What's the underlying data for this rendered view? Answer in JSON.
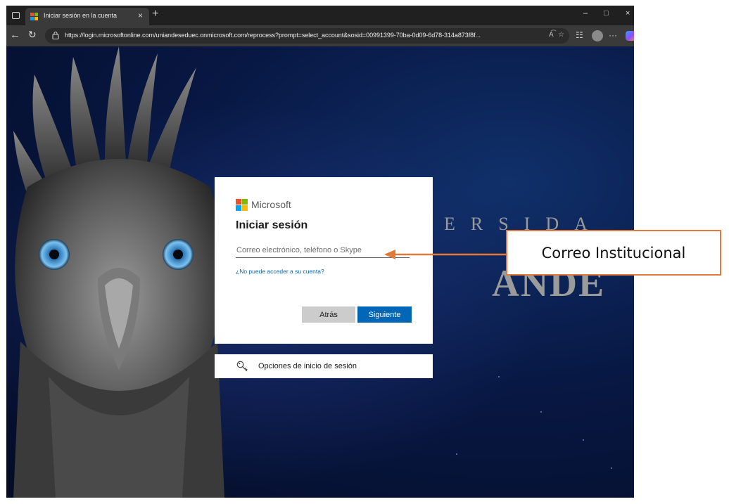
{
  "browser": {
    "tab_title": "Iniciar sesión en la cuenta",
    "url": "https://login.microsoftonline.com/uniandeseduec.onmicrosoft.com/reprocess?prompt=select_account&sosid=00991399-70ba-0d09-6d78-314a873f8f...",
    "window_controls": {
      "minimize": "–",
      "maximize": "□",
      "close": "×"
    },
    "close_tab_glyph": "×",
    "new_tab_glyph": "+",
    "more_glyph": "···"
  },
  "background": {
    "word_top": "ERSIDA",
    "word_bottom": "ANDE"
  },
  "login": {
    "brand": "Microsoft",
    "title": "Iniciar sesión",
    "email_placeholder": "Correo electrónico, teléfono o Skype",
    "email_value": "",
    "cant_access": "¿No puede acceder a su cuenta?",
    "back_label": "Atrás",
    "next_label": "Siguiente",
    "signin_options": "Opciones de inicio de sesión"
  },
  "annotation": {
    "label": "Correo Institucional",
    "color": "#e07a3a"
  },
  "colors": {
    "ms_red": "#f25022",
    "ms_green": "#7fba00",
    "ms_blue": "#00a4ef",
    "ms_yellow": "#ffb900",
    "primary": "#0067b8"
  }
}
